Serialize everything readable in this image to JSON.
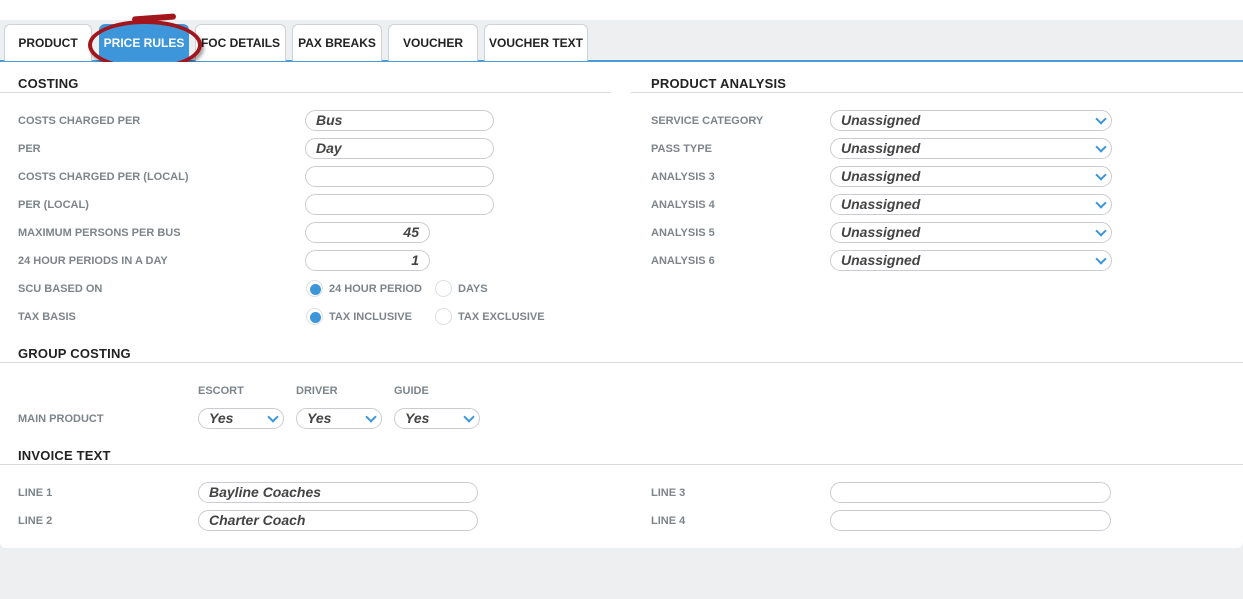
{
  "tabs": [
    {
      "label": "PRODUCT",
      "active": false
    },
    {
      "label": "PRICE RULES",
      "active": true
    },
    {
      "label": "FOC DETAILS",
      "active": false
    },
    {
      "label": "PAX BREAKS",
      "active": false
    },
    {
      "label": "VOUCHER",
      "active": false
    },
    {
      "label": "VOUCHER TEXT",
      "active": false
    }
  ],
  "costing": {
    "title": "COSTING",
    "costs_charged_per": {
      "label": "COSTS CHARGED PER",
      "value": "Bus"
    },
    "per": {
      "label": "PER",
      "value": "Day"
    },
    "costs_charged_per_local": {
      "label": "COSTS CHARGED PER (LOCAL)",
      "value": ""
    },
    "per_local": {
      "label": "PER (LOCAL)",
      "value": ""
    },
    "max_persons": {
      "label": "MAXIMUM PERSONS PER BUS",
      "value": "45"
    },
    "periods_in_day": {
      "label": "24 HOUR PERIODS IN A DAY",
      "value": "1"
    },
    "scu_based_on": {
      "label": "SCU BASED ON",
      "options": [
        "24 HOUR PERIOD",
        "DAYS"
      ],
      "selected": "24 HOUR PERIOD"
    },
    "tax_basis": {
      "label": "TAX BASIS",
      "options": [
        "TAX INCLUSIVE",
        "TAX EXCLUSIVE"
      ],
      "selected": "TAX INCLUSIVE"
    }
  },
  "product_analysis": {
    "title": "PRODUCT ANALYSIS",
    "rows": [
      {
        "label": "SERVICE CATEGORY",
        "value": "Unassigned"
      },
      {
        "label": "PASS TYPE",
        "value": "Unassigned"
      },
      {
        "label": "ANALYSIS 3",
        "value": "Unassigned"
      },
      {
        "label": "ANALYSIS 4",
        "value": "Unassigned"
      },
      {
        "label": "ANALYSIS 5",
        "value": "Unassigned"
      },
      {
        "label": "ANALYSIS 6",
        "value": "Unassigned"
      }
    ]
  },
  "group_costing": {
    "title": "GROUP COSTING",
    "columns": [
      "ESCORT",
      "DRIVER",
      "GUIDE"
    ],
    "row_label": "MAIN PRODUCT",
    "values": [
      "Yes",
      "Yes",
      "Yes"
    ]
  },
  "invoice_text": {
    "title": "INVOICE TEXT",
    "line1": {
      "label": "LINE 1",
      "value": "Bayline Coaches"
    },
    "line2": {
      "label": "LINE 2",
      "value": "Charter Coach"
    },
    "line3": {
      "label": "LINE 3",
      "value": ""
    },
    "line4": {
      "label": "LINE 4",
      "value": ""
    }
  },
  "colors": {
    "accent": "#3d96d9",
    "annotation": "#a3151c",
    "background": "#edeff0"
  }
}
